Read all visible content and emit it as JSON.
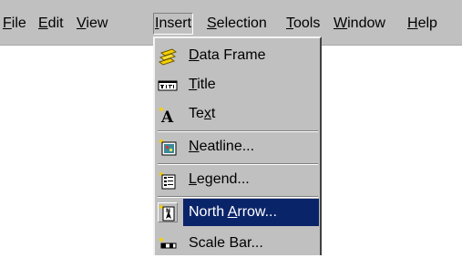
{
  "menubar": {
    "items": [
      {
        "before": "",
        "key": "F",
        "after": "ile"
      },
      {
        "before": "",
        "key": "E",
        "after": "dit"
      },
      {
        "before": "",
        "key": "V",
        "after": "iew"
      },
      {
        "before": "",
        "key": "I",
        "after": "nsert"
      },
      {
        "before": "",
        "key": "S",
        "after": "election"
      },
      {
        "before": "",
        "key": "T",
        "after": "ools"
      },
      {
        "before": "",
        "key": "W",
        "after": "indow"
      },
      {
        "before": "",
        "key": "H",
        "after": "elp"
      }
    ],
    "active": "Insert"
  },
  "insert_menu": {
    "items": [
      {
        "before": "",
        "key": "D",
        "after": "ata Frame",
        "icon": "data-frame-icon"
      },
      {
        "before": "",
        "key": "T",
        "after": "itle",
        "icon": "title-icon"
      },
      {
        "before": "Te",
        "key": "x",
        "after": "t",
        "icon": "text-icon"
      },
      {
        "before": "",
        "key": "N",
        "after": "eatline...",
        "icon": "neatline-icon"
      },
      {
        "before": "",
        "key": "L",
        "after": "egend...",
        "icon": "legend-icon"
      },
      {
        "before": "North ",
        "key": "A",
        "after": "rrow...",
        "icon": "north-arrow-icon"
      },
      {
        "before": "Scale Bar...",
        "key": "",
        "after": "",
        "icon": "scale-bar-icon"
      }
    ],
    "highlighted": "North Arrow...",
    "colors": {
      "highlight": "#0a246a",
      "menu_bg": "#c0c0c0"
    }
  }
}
